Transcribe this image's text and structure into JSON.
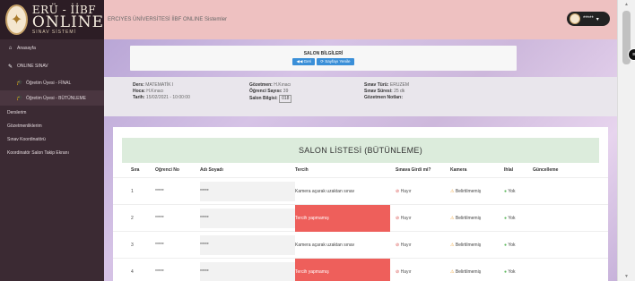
{
  "logo": {
    "line1": "ERÜ - İİBF",
    "line2": "ONLINE",
    "line3": "SINAV SİSTEMİ"
  },
  "topbar": {
    "title": "ERCIYES ÜNİVERSİTESİ İİBF ONLINE Sistemler",
    "user_masked": "*****"
  },
  "sidebar": {
    "items": [
      {
        "label": "Anasayfa",
        "icon": "home-icon"
      },
      {
        "label": "ONLINE SINAV",
        "icon": "pencil-icon"
      },
      {
        "label": "Öğretim Üyesi - FİNAL",
        "icon": "graduation-cap-icon"
      },
      {
        "label": "Öğretim Üyesi - BÜTÜNLEME",
        "icon": "graduation-cap-icon"
      },
      {
        "label": "Derslerim"
      },
      {
        "label": "Gözetmenliklerim"
      },
      {
        "label": "Sınav Koordinatörü"
      },
      {
        "label": "Koordinatör Salon Takip Ekranı"
      }
    ]
  },
  "info": {
    "title": "SALON BİLGİLERİ",
    "back_button": "Geri",
    "refresh_button": "Sayfayı Yenile"
  },
  "details": {
    "ders_label": "Ders:",
    "ders_value": "MATEMATİK I",
    "hoca_label": "Hoca:",
    "hoca_value": "H.Kınacı",
    "tarih_label": "Tarih:",
    "tarih_value": "15/02/2021 - 10:00:00",
    "gozetmen_label": "Gözetmen:",
    "gozetmen_value": "H.Kınacı",
    "ogrenci_sayisi_label": "Öğrenci Sayısı:",
    "ogrenci_sayisi_value": "39",
    "salon_label": "Salon Bilgisi:",
    "salon_value": "018",
    "sinav_turu_label": "Sınav Türü:",
    "sinav_turu_value": "ERUZEM",
    "sinav_suresi_label": "Sınav Süresi:",
    "sinav_suresi_value": "25 dk",
    "gozetmen_notlari_label": "Gözetmen Notları:"
  },
  "list": {
    "title": "SALON LİSTESİ (BÜTÜNLEME)",
    "columns": [
      "Sıra",
      "Öğrenci No",
      "Adı Soyadı",
      "Tercih",
      "Sınava Girdi mi?",
      "Kamera",
      "İhlal",
      "Güncelleme"
    ],
    "rows": [
      {
        "sira": "1",
        "no": "*****",
        "ad": "*****",
        "tercih": "Kamera açarak uzaktan sınav",
        "tercih_missing": false,
        "girdi": "Hayır",
        "kamera": "Belirtilmemiş",
        "ihlal": "Yok"
      },
      {
        "sira": "2",
        "no": "*****",
        "ad": "*****",
        "tercih": "Tercih yapmamış",
        "tercih_missing": true,
        "girdi": "Hayır",
        "kamera": "Belirtilmemiş",
        "ihlal": "Yok"
      },
      {
        "sira": "3",
        "no": "*****",
        "ad": "*****",
        "tercih": "Kamera açarak uzaktan sınav",
        "tercih_missing": false,
        "girdi": "Hayır",
        "kamera": "Belirtilmemiş",
        "ihlal": "Yok"
      },
      {
        "sira": "4",
        "no": "*****",
        "ad": "*****",
        "tercih": "Tercih yapmamış",
        "tercih_missing": true,
        "girdi": "Hayır",
        "kamera": "Belirtilmemiş",
        "ihlal": "Yok"
      }
    ]
  }
}
